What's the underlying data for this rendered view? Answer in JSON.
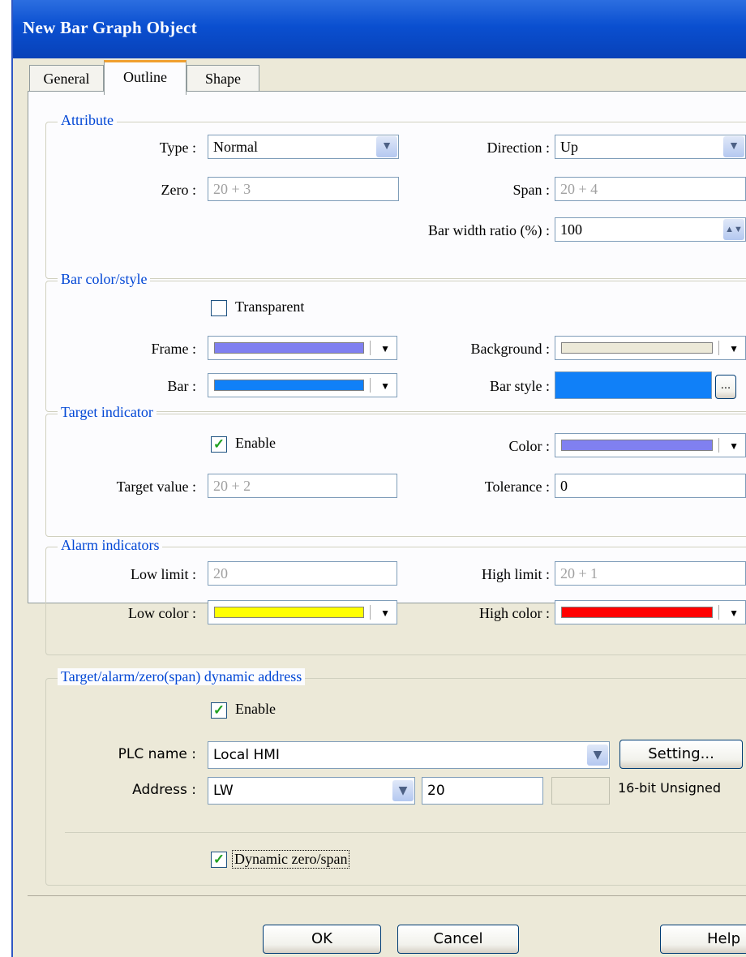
{
  "window": {
    "title": "New  Bar Graph Object"
  },
  "tabs": [
    {
      "label": "General"
    },
    {
      "label": "Outline"
    },
    {
      "label": "Shape"
    }
  ],
  "attribute": {
    "legend": "Attribute",
    "type_label": "Type :",
    "type_value": "Normal",
    "direction_label": "Direction :",
    "direction_value": "Up",
    "zero_label": "Zero :",
    "zero_value": "20 + 3",
    "span_label": "Span :",
    "span_value": "20 + 4",
    "bar_width_label": "Bar width ratio (%) :",
    "bar_width_value": "100"
  },
  "bar_color": {
    "legend": "Bar color/style",
    "transparent_label": "Transparent",
    "transparent_checked": false,
    "frame_label": "Frame :",
    "frame_color": "#8080f0",
    "background_label": "Background :",
    "background_color": "#ece9d8",
    "bar_label": "Bar :",
    "bar_color": "#1080f8",
    "bar_style_label": "Bar style :",
    "bar_style_color": "#1080f8",
    "bar_style_button": "..."
  },
  "target": {
    "legend": "Target indicator",
    "enable_label": "Enable",
    "enable_checked": true,
    "color_label": "Color :",
    "color_value": "#8080f0",
    "target_value_label": "Target value :",
    "target_value": "20 + 2",
    "tolerance_label": "Tolerance :",
    "tolerance_value": "0"
  },
  "alarm": {
    "legend": "Alarm indicators",
    "low_limit_label": "Low limit :",
    "low_limit_value": "20",
    "high_limit_label": "High limit :",
    "high_limit_value": "20 + 1",
    "low_color_label": "Low color :",
    "low_color": "#ffff00",
    "high_color_label": "High color :",
    "high_color": "#ff0000"
  },
  "dynamic": {
    "legend": "Target/alarm/zero(span) dynamic address",
    "enable_label": "Enable",
    "enable_checked": true,
    "plc_label": "PLC name :",
    "plc_value": "Local HMI",
    "setting_button": "Setting...",
    "address_label": "Address :",
    "address_device": "LW",
    "address_value": "20",
    "data_format": "16-bit Unsigned",
    "dynamic_zero_label": "Dynamic zero/span",
    "dynamic_zero_checked": true
  },
  "buttons": {
    "ok": "OK",
    "cancel": "Cancel",
    "help": "Help"
  }
}
